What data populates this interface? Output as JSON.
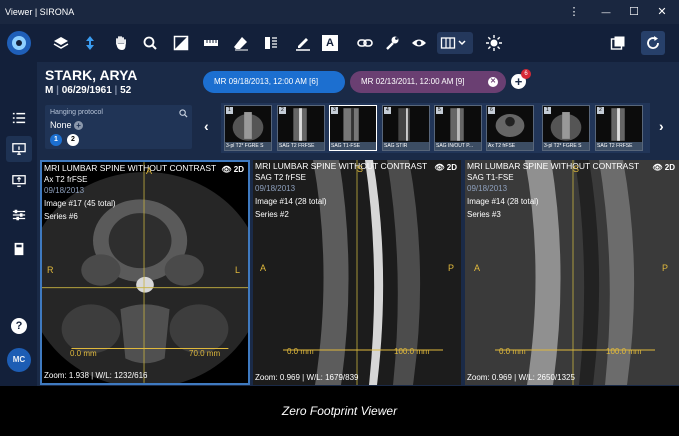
{
  "window": {
    "title": "Viewer | SIRONA",
    "menu_glyph": "⋮",
    "min_glyph": "—",
    "max_glyph": "☐",
    "close_glyph": "✕"
  },
  "toolbar": {
    "icons": [
      "logo-icon",
      "layers-icon",
      "scroll-icon",
      "pan-hand-icon",
      "zoom-icon",
      "window-level-icon",
      "ruler-icon",
      "eraser-icon",
      "invert-icon",
      "annotate-pen-icon",
      "text-annotation-icon",
      "link-icon",
      "wrench-icon",
      "eye-icon",
      "layout-icon",
      "brightness-icon",
      "export-icon",
      "refresh-icon"
    ],
    "text_tool_glyph": "A"
  },
  "sidebar": {
    "icons": [
      "list-icon",
      "monitor-icon",
      "monitor-share-icon",
      "sliders-icon",
      "book-icon",
      "help-icon"
    ],
    "avatar": "MC",
    "help_glyph": "?"
  },
  "patient": {
    "name": "STARK, ARYA",
    "sex": "M",
    "dob": "06/29/1961",
    "age": "52"
  },
  "hanging_protocol": {
    "label": "Hanging protocol",
    "value": "None",
    "chips": [
      "1",
      "2"
    ]
  },
  "studies": [
    {
      "label": "MR 09/18/2013, 12:00 AM [6]",
      "color": "#1c6fd0"
    },
    {
      "label": "MR 02/13/2011, 12:00 AM [9]",
      "color": "#6a3f72"
    }
  ],
  "add_study": {
    "badge": "6",
    "glyph": "+"
  },
  "thumbnails": [
    {
      "num": "1",
      "label": "3-pl T2* FGRE S"
    },
    {
      "num": "2",
      "label": "SAG T2 FRFSE"
    },
    {
      "num": "3",
      "label": "SAG T1-FSE"
    },
    {
      "num": "4",
      "label": "SAG STIR"
    },
    {
      "num": "5",
      "label": "SAG IN/OUT P..."
    },
    {
      "num": "6",
      "label": "Ax T2 frFSE"
    },
    {
      "num": "1",
      "label": "3-pl T2* FGRE S"
    },
    {
      "num": "2",
      "label": "SAG T2 FRFSE"
    }
  ],
  "nav": {
    "left": "‹",
    "right": "›"
  },
  "viewports": [
    {
      "title": "MRI LUMBAR SPINE WITHOUT CONTRAST",
      "series_name": "Ax T2 frFSE",
      "date": "09/18/2013",
      "image": "Image #17 (45 total)",
      "series": "Series #6",
      "mode": "2D",
      "eye": "👁",
      "zoom": "Zoom: 1.938 | W/L: 1232/616",
      "scale_start": "0.0 mm",
      "scale_end": "70.0 mm",
      "o_top": "A",
      "o_left": "R",
      "o_right": "L"
    },
    {
      "title": "MRI LUMBAR SPINE WITHOUT CONTRAST",
      "series_name": "SAG T2 frFSE",
      "date": "09/18/2013",
      "image": "Image #14 (28 total)",
      "series": "Series #2",
      "mode": "2D",
      "eye": "👁",
      "zoom": "Zoom: 0.969 | W/L: 1679/839",
      "scale_start": "0.0 mm",
      "scale_end": "100.0 mm",
      "o_top": "S",
      "o_left": "A",
      "o_right": "P"
    },
    {
      "title": "MRI LUMBAR SPINE WITHOUT CONTRAST",
      "series_name": "SAG T1-FSE",
      "date": "09/18/2013",
      "image": "Image #14 (28 total)",
      "series": "Series #3",
      "mode": "2D",
      "eye": "👁",
      "zoom": "Zoom: 0.969 | W/L: 2650/1325",
      "scale_start": "0.0 mm",
      "scale_end": "100.0 mm",
      "o_top": "S",
      "o_left": "A",
      "o_right": "P"
    }
  ],
  "caption": "Zero Footprint Viewer"
}
